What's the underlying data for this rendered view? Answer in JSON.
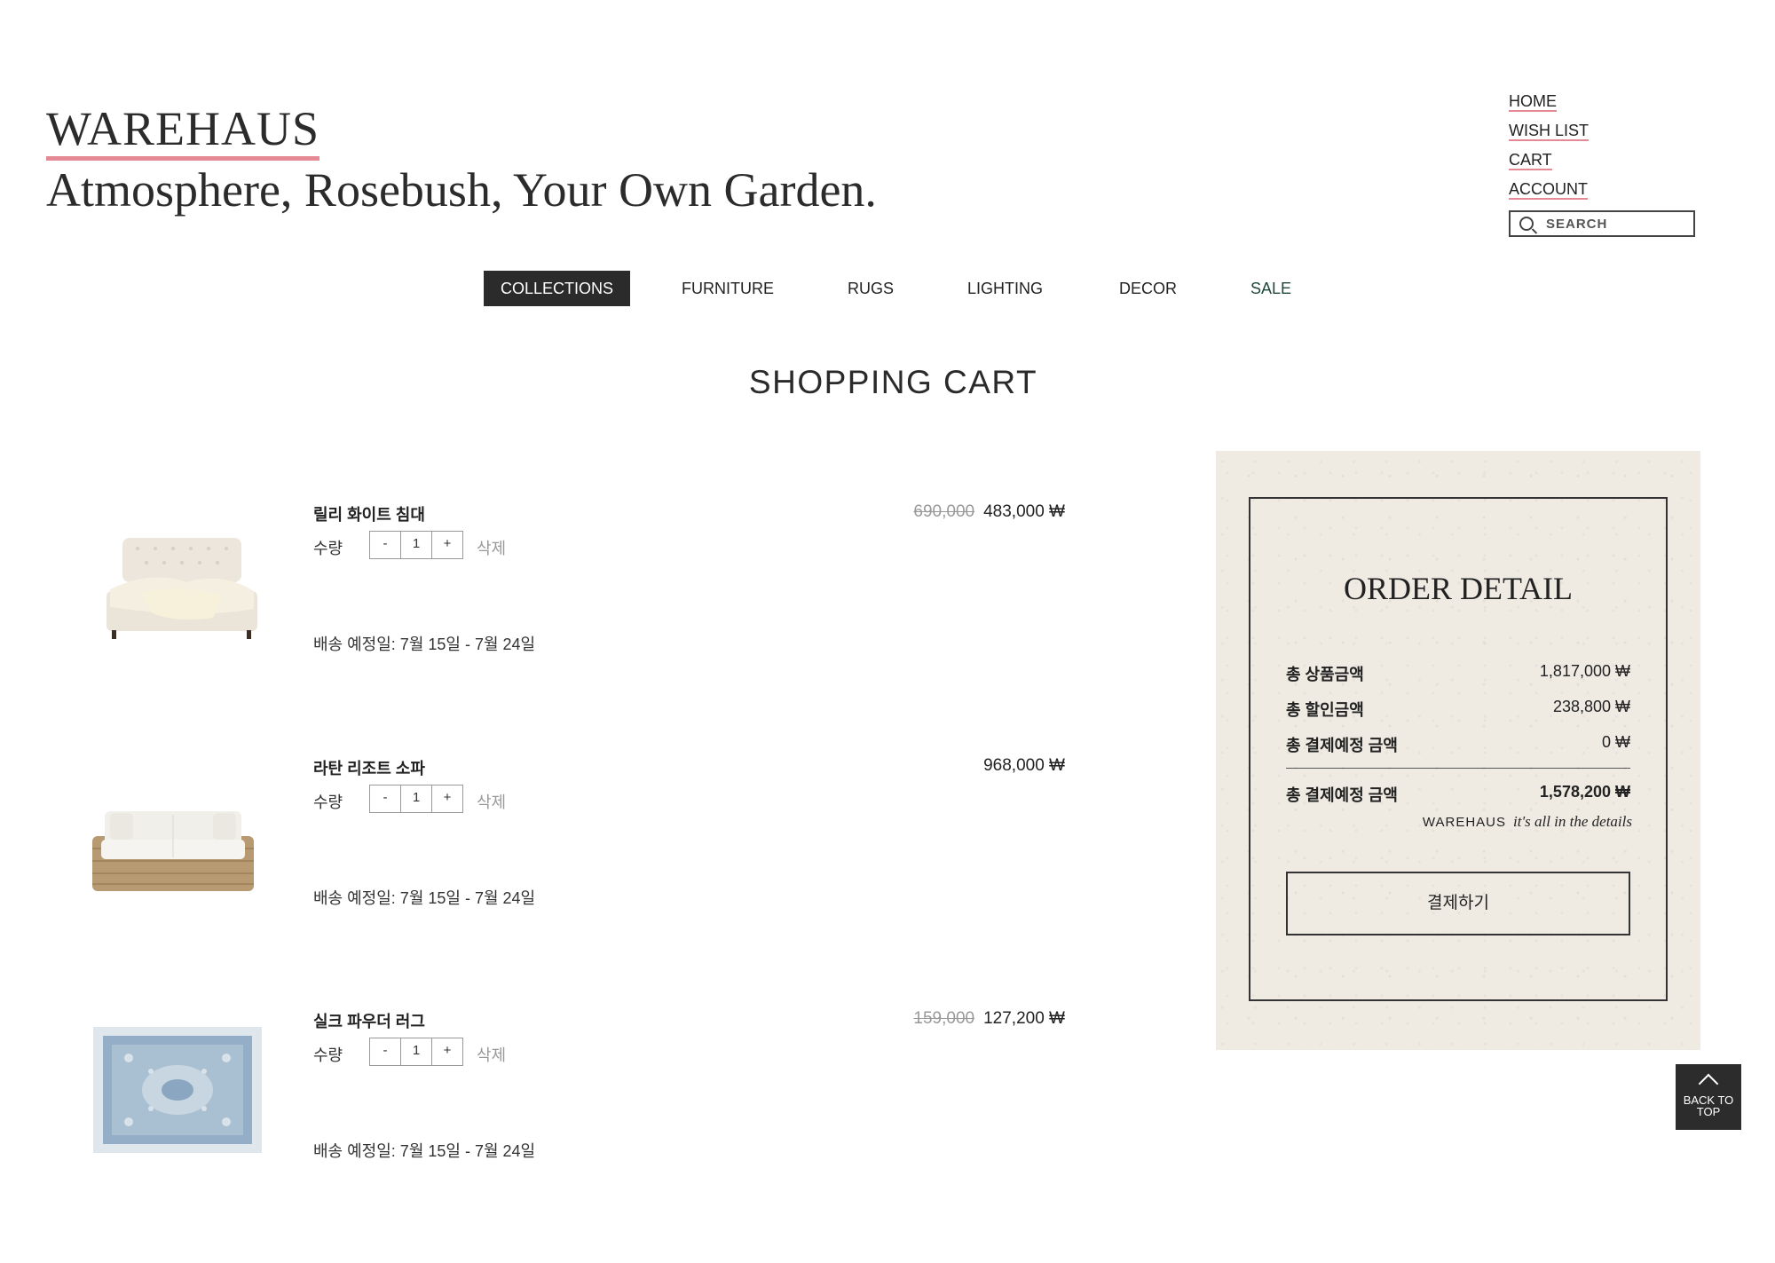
{
  "brand": {
    "logo": "WAREHAUS",
    "tagline": "Atmosphere, Rosebush, Your Own Garden."
  },
  "top_links": [
    "HOME",
    "WISH LIST",
    "CART",
    "ACCOUNT"
  ],
  "search": {
    "placeholder": "SEARCH"
  },
  "categories": [
    "COLLECTIONS",
    "FURNITURE",
    "RUGS",
    "LIGHTING",
    "DECOR",
    "SALE"
  ],
  "page_title": "SHOPPING CART",
  "cart": {
    "qty_label": "수량",
    "remove_label": "삭제",
    "items": [
      {
        "name": "릴리 화이트 침대",
        "original_price": "690,000",
        "price": "483,000 ₩",
        "qty": "1",
        "shipping": "배송 예정일: 7월 15일 - 7월 24일"
      },
      {
        "name": "라탄 리조트 소파",
        "original_price": "",
        "price": "968,000 ₩",
        "qty": "1",
        "shipping": "배송 예정일: 7월 15일 - 7월 24일"
      },
      {
        "name": "실크 파우더 러그",
        "original_price": "159,000",
        "price": "127,200 ₩",
        "qty": "1",
        "shipping": "배송 예정일: 7월 15일 - 7월 24일"
      }
    ]
  },
  "order": {
    "title": "ORDER DETAIL",
    "rows": [
      {
        "label": "총 상품금액",
        "value": "1,817,000 ₩"
      },
      {
        "label": "총 할인금액",
        "value": "238,800 ₩"
      },
      {
        "label": "총 결제예정 금액",
        "value": "0 ₩"
      }
    ],
    "total": {
      "label": "총 결제예정 금액",
      "value": "1,578,200 ₩"
    },
    "slogan_brand": "WAREHAUS",
    "slogan_text": "it's all in the details",
    "pay_button": "결제하기"
  },
  "back_to_top": "BACK TO TOP",
  "colors": {
    "accent_underline": "#e58a94",
    "dark": "#2b2b2b",
    "panel_bg": "#efebe3",
    "sale": "#1f4a3a"
  }
}
